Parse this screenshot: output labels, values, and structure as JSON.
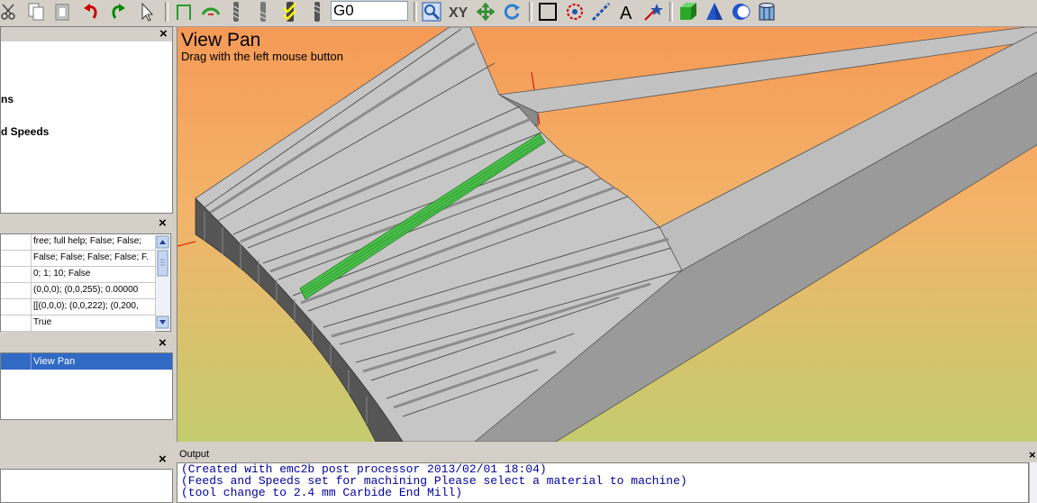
{
  "toolbar": {
    "g_code_value": "G0",
    "icons": [
      "cut-icon",
      "copy-icon",
      "paste-icon",
      "undo-icon",
      "redo-icon",
      "select-arrow-icon",
      "profile-icon",
      "pocket-icon",
      "tool-icon",
      "tool-2-icon",
      "check-icon",
      "tool-3-icon",
      "zoom-icon",
      "xy-icon",
      "pan-icon",
      "rotate-icon",
      "rectangle-icon",
      "circle-select-icon",
      "line-icon",
      "text-icon",
      "star-icon",
      "box-icon",
      "cone-icon",
      "sphere-icon",
      "cylinder-icon"
    ]
  },
  "tree": {
    "items": [
      "ns",
      "d Speeds"
    ]
  },
  "properties": {
    "rows": [
      "free; full help; False; False;",
      "False; False; False; False; F.",
      "0; 1; 10; False",
      "(0,0,0); (0,0,255); 0.00000",
      "[[(0,0,0); (0,0,222); (0,200,",
      "True"
    ]
  },
  "list": {
    "selected": "View Pan"
  },
  "view": {
    "title": "View Pan",
    "subtitle": "Drag with the left mouse button"
  },
  "output": {
    "title": "Output",
    "lines": [
      "(Created with emc2b post processor 2013/02/01 18:04)",
      "(Feeds and Speeds set for machining Please select a material to machine)",
      "(tool change to 2.4 mm Carbide End Mill)"
    ]
  },
  "colors": {
    "toolpath": "#3fbf3f",
    "selection": "#316ac5",
    "model": "#b4b4b4"
  }
}
